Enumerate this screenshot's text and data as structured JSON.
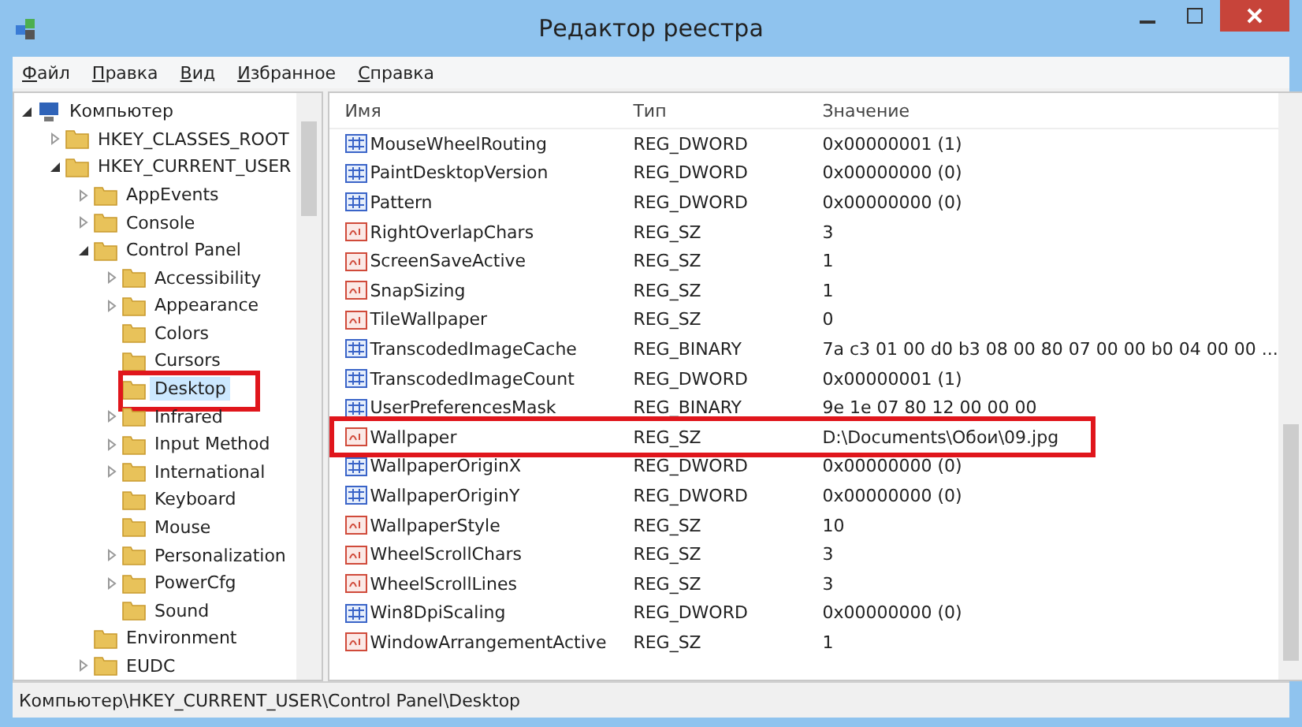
{
  "window": {
    "title": "Редактор реестра"
  },
  "menu": [
    "Файл",
    "Правка",
    "Вид",
    "Избранное",
    "Справка"
  ],
  "tree": [
    {
      "label": "Компьютер",
      "kind": "computer",
      "expanded": true,
      "selected": false,
      "children": [
        {
          "label": "HKEY_CLASSES_ROOT",
          "expanded": false,
          "selected": false
        },
        {
          "label": "HKEY_CURRENT_USER",
          "expanded": true,
          "selected": false,
          "children": [
            {
              "label": "AppEvents",
              "expanded": false,
              "selected": false
            },
            {
              "label": "Console",
              "expanded": false,
              "selected": false
            },
            {
              "label": "Control Panel",
              "expanded": true,
              "selected": false,
              "children": [
                {
                  "label": "Accessibility",
                  "expanded": false,
                  "selected": false
                },
                {
                  "label": "Appearance",
                  "expanded": false,
                  "selected": false
                },
                {
                  "label": "Colors",
                  "selected": false
                },
                {
                  "label": "Cursors",
                  "selected": false
                },
                {
                  "label": "Desktop",
                  "selected": true,
                  "highlighted": true
                },
                {
                  "label": "Infrared",
                  "expanded": false,
                  "selected": false
                },
                {
                  "label": "Input Method",
                  "expanded": false,
                  "selected": false
                },
                {
                  "label": "International",
                  "expanded": false,
                  "selected": false
                },
                {
                  "label": "Keyboard",
                  "selected": false
                },
                {
                  "label": "Mouse",
                  "selected": false
                },
                {
                  "label": "Personalization",
                  "expanded": false,
                  "selected": false
                },
                {
                  "label": "PowerCfg",
                  "expanded": false,
                  "selected": false
                },
                {
                  "label": "Sound",
                  "selected": false
                }
              ]
            },
            {
              "label": "Environment",
              "selected": false
            },
            {
              "label": "EUDC",
              "expanded": false,
              "selected": false
            }
          ]
        }
      ]
    }
  ],
  "table": {
    "columns": [
      "Имя",
      "Тип",
      "Значение"
    ],
    "rows": [
      {
        "kind": "binary",
        "name": "MouseWheelRouting",
        "type": "REG_DWORD",
        "value": "0x00000001 (1)"
      },
      {
        "kind": "binary",
        "name": "PaintDesktopVersion",
        "type": "REG_DWORD",
        "value": "0x00000000 (0)"
      },
      {
        "kind": "binary",
        "name": "Pattern",
        "type": "REG_DWORD",
        "value": "0x00000000 (0)"
      },
      {
        "kind": "string",
        "name": "RightOverlapChars",
        "type": "REG_SZ",
        "value": "3"
      },
      {
        "kind": "string",
        "name": "ScreenSaveActive",
        "type": "REG_SZ",
        "value": "1"
      },
      {
        "kind": "string",
        "name": "SnapSizing",
        "type": "REG_SZ",
        "value": "1"
      },
      {
        "kind": "string",
        "name": "TileWallpaper",
        "type": "REG_SZ",
        "value": "0"
      },
      {
        "kind": "binary",
        "name": "TranscodedImageCache",
        "type": "REG_BINARY",
        "value": "7a c3 01 00 d0 b3 08 00 80 07 00 00 b0 04 00 00 ..."
      },
      {
        "kind": "binary",
        "name": "TranscodedImageCount",
        "type": "REG_DWORD",
        "value": "0x00000001 (1)"
      },
      {
        "kind": "binary",
        "name": "UserPreferencesMask",
        "type": "REG_BINARY",
        "value": "9e 1e 07 80 12 00 00 00"
      },
      {
        "kind": "string",
        "name": "Wallpaper",
        "type": "REG_SZ",
        "value": "D:\\Documents\\Обои\\09.jpg",
        "highlighted": true
      },
      {
        "kind": "binary",
        "name": "WallpaperOriginX",
        "type": "REG_DWORD",
        "value": "0x00000000 (0)"
      },
      {
        "kind": "binary",
        "name": "WallpaperOriginY",
        "type": "REG_DWORD",
        "value": "0x00000000 (0)"
      },
      {
        "kind": "string",
        "name": "WallpaperStyle",
        "type": "REG_SZ",
        "value": "10"
      },
      {
        "kind": "string",
        "name": "WheelScrollChars",
        "type": "REG_SZ",
        "value": "3"
      },
      {
        "kind": "string",
        "name": "WheelScrollLines",
        "type": "REG_SZ",
        "value": "3"
      },
      {
        "kind": "binary",
        "name": "Win8DpiScaling",
        "type": "REG_DWORD",
        "value": "0x00000000 (0)"
      },
      {
        "kind": "string",
        "name": "WindowArrangementActive",
        "type": "REG_SZ",
        "value": "1"
      }
    ]
  },
  "status_bar": "Компьютер\\HKEY_CURRENT_USER\\Control Panel\\Desktop"
}
